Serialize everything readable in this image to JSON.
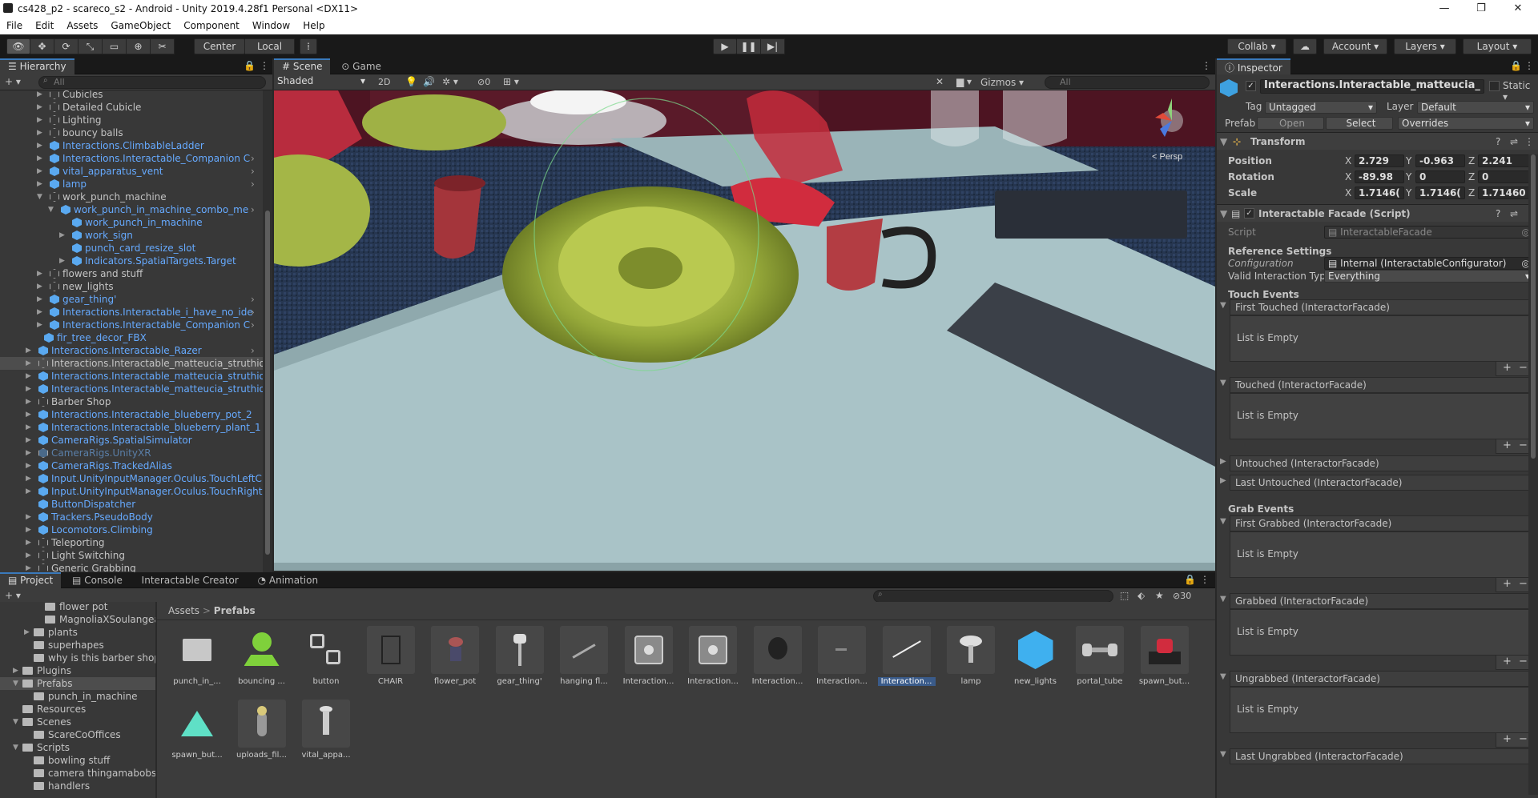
{
  "window": {
    "title": "cs428_p2 - scareco_s2 - Android - Unity 2019.4.28f1 Personal <DX11>"
  },
  "menu": [
    "File",
    "Edit",
    "Assets",
    "GameObject",
    "Component",
    "Window",
    "Help"
  ],
  "toolbar": {
    "center": "Center",
    "local": "Local",
    "collab": "Collab ▾",
    "account": "Account",
    "layers": "Layers",
    "layout": "Layout"
  },
  "hierarchy": {
    "title": "Hierarchy",
    "search_placeholder": "All",
    "items": [
      {
        "label": "Cubicles",
        "indent": 1,
        "arrow": "▶",
        "blue": false
      },
      {
        "label": "Detailed Cubicle",
        "indent": 1,
        "arrow": "▶",
        "blue": false
      },
      {
        "label": "Lighting",
        "indent": 1,
        "arrow": "▶",
        "blue": false
      },
      {
        "label": "bouncy balls",
        "indent": 1,
        "arrow": "▶",
        "blue": false
      },
      {
        "label": "Interactions.ClimbableLadder",
        "indent": 1,
        "arrow": "▶",
        "blue": true
      },
      {
        "label": "Interactions.Interactable_Companion C",
        "indent": 1,
        "arrow": "▶",
        "blue": true,
        "chev": true
      },
      {
        "label": "vital_apparatus_vent",
        "indent": 1,
        "arrow": "▶",
        "blue": true,
        "chev": true
      },
      {
        "label": "lamp",
        "indent": 1,
        "arrow": "▶",
        "blue": true,
        "chev": true
      },
      {
        "label": "work_punch_machine",
        "indent": 1,
        "arrow": "▼",
        "blue": false
      },
      {
        "label": "work_punch_in_machine_combo_me",
        "indent": 2,
        "arrow": "▼",
        "blue": true,
        "chev": true
      },
      {
        "label": "work_punch_in_machine",
        "indent": 3,
        "arrow": "",
        "blue": true
      },
      {
        "label": "work_sign",
        "indent": 3,
        "arrow": "▶",
        "blue": true
      },
      {
        "label": "punch_card_resize_slot",
        "indent": 3,
        "arrow": "",
        "blue": true
      },
      {
        "label": "Indicators.SpatialTargets.Target",
        "indent": 3,
        "arrow": "▶",
        "blue": true
      },
      {
        "label": "flowers and stuff",
        "indent": 1,
        "arrow": "▶",
        "blue": false
      },
      {
        "label": "new_lights",
        "indent": 1,
        "arrow": "▶",
        "blue": false
      },
      {
        "label": "gear_thing'",
        "indent": 1,
        "arrow": "▶",
        "blue": true,
        "chev": true
      },
      {
        "label": "Interactions.Interactable_i_have_no_ide",
        "indent": 1,
        "arrow": "▶",
        "blue": true,
        "chev": true
      },
      {
        "label": "Interactions.Interactable_Companion C",
        "indent": 1,
        "arrow": "▶",
        "blue": true,
        "chev": true
      },
      {
        "label": "fir_tree_decor_FBX",
        "indent": 0.5,
        "arrow": "",
        "blue": true
      },
      {
        "label": "Interactions.Interactable_Razer",
        "indent": 0,
        "arrow": "▶",
        "blue": true,
        "chev": true
      },
      {
        "label": "Interactions.Interactable_matteucia_struthiop",
        "indent": 0,
        "arrow": "▶",
        "blue": false,
        "sel": true
      },
      {
        "label": "Interactions.Interactable_matteucia_struthiop",
        "indent": 0,
        "arrow": "▶",
        "blue": true
      },
      {
        "label": "Interactions.Interactable_matteucia_struthiop",
        "indent": 0,
        "arrow": "▶",
        "blue": true
      },
      {
        "label": "Barber Shop",
        "indent": 0,
        "arrow": "▶",
        "blue": false
      },
      {
        "label": "Interactions.Interactable_blueberry_pot_2",
        "indent": 0,
        "arrow": "▶",
        "blue": true
      },
      {
        "label": "Interactions.Interactable_blueberry_plant_1",
        "indent": 0,
        "arrow": "▶",
        "blue": true
      },
      {
        "label": "CameraRigs.SpatialSimulator",
        "indent": 0,
        "arrow": "▶",
        "blue": true
      },
      {
        "label": "CameraRigs.UnityXR",
        "indent": 0,
        "arrow": "▶",
        "blue": false,
        "dim": true
      },
      {
        "label": "CameraRigs.TrackedAlias",
        "indent": 0,
        "arrow": "▶",
        "blue": true
      },
      {
        "label": "Input.UnityInputManager.Oculus.TouchLeftC",
        "indent": 0,
        "arrow": "▶",
        "blue": true
      },
      {
        "label": "Input.UnityInputManager.Oculus.TouchRight",
        "indent": 0,
        "arrow": "▶",
        "blue": true
      },
      {
        "label": "ButtonDispatcher",
        "indent": 0,
        "arrow": "",
        "blue": true
      },
      {
        "label": "Trackers.PseudoBody",
        "indent": 0,
        "arrow": "▶",
        "blue": true
      },
      {
        "label": "Locomotors.Climbing",
        "indent": 0,
        "arrow": "▶",
        "blue": true
      },
      {
        "label": "Teleporting",
        "indent": 0,
        "arrow": "▶",
        "blue": false
      },
      {
        "label": "Light Switching",
        "indent": 0,
        "arrow": "▶",
        "blue": false
      },
      {
        "label": "Generic Grabbing",
        "indent": 0,
        "arrow": "▶",
        "blue": false
      }
    ]
  },
  "scene": {
    "tab_scene": "Scene",
    "tab_game": "Game",
    "shading": "Shaded",
    "mode_2d": "2D",
    "hidden_count": "0",
    "gizmos": "Gizmos",
    "search_placeholder": "All",
    "persp": "< Persp"
  },
  "inspector": {
    "title": "Inspector",
    "object_name": "Interactions.Interactable_matteucia_",
    "static": "Static ▾",
    "tag_label": "Tag",
    "tag_value": "Untagged",
    "layer_label": "Layer",
    "layer_value": "Default",
    "prefab_label": "Prefab",
    "open": "Open",
    "select": "Select",
    "overrides": "Overrides",
    "transform": "Transform",
    "position_label": "Position",
    "pos": {
      "x": "2.729",
      "y": "-0.963",
      "z": "2.241"
    },
    "rotation_label": "Rotation",
    "rot": {
      "x": "-89.98",
      "y": "0",
      "z": "0"
    },
    "scale_label": "Scale",
    "scale": {
      "x": "1.7146(",
      "y": "1.7146(",
      "z": "1.71460"
    },
    "facade": "Interactable Facade (Script)",
    "script_label": "Script",
    "script_value": "InteractableFacade",
    "ref_settings": "Reference Settings",
    "config_label": "Configuration",
    "config_value": "Internal (InteractableConfigurator)",
    "valid_label": "Valid Interaction Types",
    "valid_value": "Everything",
    "touch_events": "Touch Events",
    "grab_events": "Grab Events",
    "first_touched": "First Touched (InteractorFacade)",
    "touched": "Touched (InteractorFacade)",
    "untouched": "Untouched (InteractorFacade)",
    "last_untouched": "Last Untouched (InteractorFacade)",
    "first_grabbed": "First Grabbed (InteractorFacade)",
    "grabbed": "Grabbed (InteractorFacade)",
    "ungrabbed": "Ungrabbed (InteractorFacade)",
    "last_ungrabbed": "Last Ungrabbed (InteractorFacade)",
    "list_empty": "List is Empty"
  },
  "project": {
    "tab_project": "Project",
    "tab_console": "Console",
    "tab_creator": "Interactable Creator",
    "tab_animation": "Animation",
    "breadcrumb_root": "Assets",
    "breadcrumb_sep": ">",
    "breadcrumb_current": "Prefabs",
    "hidden_count": "30",
    "tree": [
      {
        "label": "flower pot",
        "indent": 3,
        "arrow": ""
      },
      {
        "label": "MagnoliaXSoulangea",
        "indent": 3,
        "arrow": ""
      },
      {
        "label": "plants",
        "indent": 2,
        "arrow": "▶"
      },
      {
        "label": "superhapes",
        "indent": 2,
        "arrow": ""
      },
      {
        "label": "why is this barber shop",
        "indent": 2,
        "arrow": ""
      },
      {
        "label": "Plugins",
        "indent": 1,
        "arrow": "▶"
      },
      {
        "label": "Prefabs",
        "indent": 1,
        "arrow": "▼",
        "sel": true
      },
      {
        "label": "punch_in_machine",
        "indent": 2,
        "arrow": ""
      },
      {
        "label": "Resources",
        "indent": 1,
        "arrow": ""
      },
      {
        "label": "Scenes",
        "indent": 1,
        "arrow": "▼"
      },
      {
        "label": "ScareCoOffices",
        "indent": 2,
        "arrow": ""
      },
      {
        "label": "Scripts",
        "indent": 1,
        "arrow": "▼"
      },
      {
        "label": "bowling stuff",
        "indent": 2,
        "arrow": ""
      },
      {
        "label": "camera thingamabobs",
        "indent": 2,
        "arrow": ""
      },
      {
        "label": "handlers",
        "indent": 2,
        "arrow": ""
      }
    ],
    "assets": [
      {
        "label": "punch_in_...",
        "icon": "folder-icon"
      },
      {
        "label": "bouncing ...",
        "icon": "ball-icon"
      },
      {
        "label": "button",
        "icon": "button-icon"
      },
      {
        "label": "CHAIR",
        "icon": "chair-icon"
      },
      {
        "label": "flower_pot",
        "icon": "flowerpot-icon"
      },
      {
        "label": "gear_thing'",
        "icon": "gear-icon"
      },
      {
        "label": "hanging fl...",
        "icon": "hanging-icon"
      },
      {
        "label": "Interaction...",
        "icon": "cube-icon"
      },
      {
        "label": "Interaction...",
        "icon": "cube-icon"
      },
      {
        "label": "Interaction...",
        "icon": "drop-icon"
      },
      {
        "label": "Interaction...",
        "icon": "flat-icon"
      },
      {
        "label": "Interaction...",
        "icon": "stick-icon",
        "sel": true
      },
      {
        "label": "lamp",
        "icon": "lamp-icon"
      },
      {
        "label": "new_lights",
        "icon": "bluecube-icon"
      },
      {
        "label": "portal_tube",
        "icon": "dumbbell-icon"
      },
      {
        "label": "spawn_but...",
        "icon": "spawnbutton-icon"
      },
      {
        "label": "spawn_but...",
        "icon": "triangle-icon"
      },
      {
        "label": "uploads_fil...",
        "icon": "vase-icon"
      },
      {
        "label": "vital_appa...",
        "icon": "vent-icon"
      }
    ]
  }
}
